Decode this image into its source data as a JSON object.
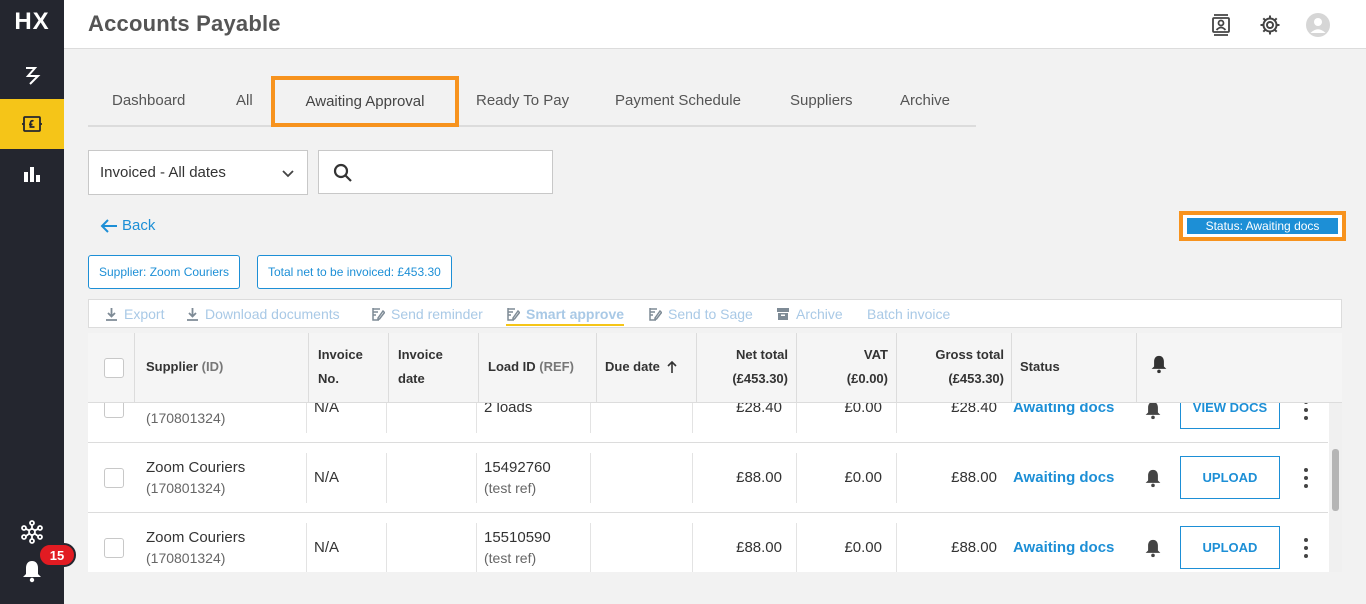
{
  "sidebar": {
    "logo": "HX",
    "notification_count": "15"
  },
  "header": {
    "title": "Accounts Payable"
  },
  "tabs": [
    {
      "label": "Dashboard"
    },
    {
      "label": "All"
    },
    {
      "label": "Awaiting Approval",
      "active": true
    },
    {
      "label": "Ready To Pay"
    },
    {
      "label": "Payment Schedule"
    },
    {
      "label": "Suppliers"
    },
    {
      "label": "Archive"
    }
  ],
  "filters": {
    "date_select": "Invoiced - All dates",
    "search_value": ""
  },
  "back_label": "Back",
  "status_filter": "Status: Awaiting docs",
  "chips": {
    "supplier": "Supplier: Zoom Couriers",
    "total": "Total net to be invoiced: £453.30"
  },
  "toolbar": {
    "export": "Export",
    "download": "Download documents",
    "reminder": "Send reminder",
    "smart": "Smart approve",
    "sage": "Send to Sage",
    "archive": "Archive",
    "batch": "Batch invoice"
  },
  "table": {
    "headers": {
      "supplier": "Supplier",
      "supplier_id": "(ID)",
      "invoice_no_1": "Invoice",
      "invoice_no_2": "No.",
      "invoice_date_1": "Invoice",
      "invoice_date_2": "date",
      "load_id": "Load ID",
      "load_ref": "(REF)",
      "due_date": "Due date",
      "net_total": "Net total",
      "net_total_sum": "(£453.30)",
      "vat": "VAT",
      "vat_sum": "(£0.00)",
      "gross_total": "Gross total",
      "gross_total_sum": "(£453.30)",
      "status": "Status"
    },
    "rows": [
      {
        "supplier": "",
        "supplier_id": "(170801324)",
        "invoice_no": "N/A",
        "load_id": "2 loads",
        "load_ref": "",
        "net": "£28.40",
        "vat": "£0.00",
        "gross": "£28.40",
        "status": "Awaiting docs",
        "action": "VIEW DOCS"
      },
      {
        "supplier": "Zoom Couriers",
        "supplier_id": "(170801324)",
        "invoice_no": "N/A",
        "load_id": "15492760",
        "load_ref": "(test ref)",
        "net": "£88.00",
        "vat": "£0.00",
        "gross": "£88.00",
        "status": "Awaiting docs",
        "action": "UPLOAD"
      },
      {
        "supplier": "Zoom Couriers",
        "supplier_id": "(170801324)",
        "invoice_no": "N/A",
        "load_id": "15510590",
        "load_ref": "(test ref)",
        "net": "£88.00",
        "vat": "£0.00",
        "gross": "£88.00",
        "status": "Awaiting docs",
        "action": "UPLOAD"
      }
    ]
  },
  "colors": {
    "accent_blue": "#1d8fd6",
    "highlight_orange": "#f7931e",
    "sidebar_bg": "#24262f",
    "active_yellow": "#f5c518",
    "badge_red": "#e21b22"
  }
}
